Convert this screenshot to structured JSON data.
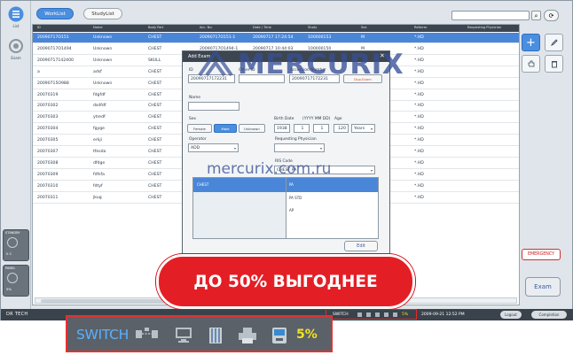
{
  "left_nav": {
    "worklist_label": "List",
    "exam_label": "Exam",
    "status_blocks": [
      {
        "label": "STANDBY",
        "value": "0 C"
      },
      {
        "label": "PANEL",
        "value": "5%"
      }
    ]
  },
  "top_bar": {
    "tabs": [
      "WorkList",
      "StudyList"
    ],
    "search_icon": "search-icon",
    "refresh_icon": "refresh-icon"
  },
  "table": {
    "columns": [
      "ID",
      "Name",
      "Body Part",
      "Acc. No.",
      "Date / Time",
      "Study",
      "Sex",
      "Referrer",
      "Requesting Physician"
    ],
    "rows": [
      {
        "id": "20090717O151",
        "name": "Unknown",
        "part": "CHEST",
        "acc": "20090717O151-1",
        "date": "20090717 17:24:54",
        "study": "100000153",
        "sex": "M",
        "ref": "*.HD",
        "selected": true
      },
      {
        "id": "20090717O1494",
        "name": "Unknown",
        "part": "CHEST",
        "acc": "20090717O1494-1",
        "date": "20090717 10:44:03",
        "study": "100000150",
        "sex": "M",
        "ref": "*.HD",
        "selected": false
      },
      {
        "id": "20090717142400",
        "name": "Unknown",
        "part": "SKULL",
        "acc": "20090717142400",
        "date": "20090717 14:23:44",
        "study": "100000153",
        "sex": "M",
        "ref": "*.HD",
        "selected": false
      },
      {
        "id": "a",
        "name": "adsf",
        "part": "CHEST",
        "acc": "",
        "date": "",
        "study": "",
        "sex": "",
        "ref": "*.HD",
        "selected": false
      },
      {
        "id": "20090715O988",
        "name": "Unknown",
        "part": "CHEST",
        "acc": "",
        "date": "",
        "study": "",
        "sex": "",
        "ref": "*.HD",
        "selected": false
      },
      {
        "id": "20070319",
        "name": "fdgfdf",
        "part": "CHEST",
        "acc": "",
        "date": "",
        "study": "",
        "sex": "",
        "ref": "*.HD",
        "selected": false
      },
      {
        "id": "20070302",
        "name": "dsdfdf",
        "part": "CHEST",
        "acc": "",
        "date": "",
        "study": "",
        "sex": "",
        "ref": "*.HD",
        "selected": false
      },
      {
        "id": "20070303",
        "name": "ytredf",
        "part": "CHEST",
        "acc": "",
        "date": "",
        "study": "",
        "sex": "",
        "ref": "*.HD",
        "selected": false
      },
      {
        "id": "20070304",
        "name": "fgyge",
        "part": "CHEST",
        "acc": "",
        "date": "",
        "study": "",
        "sex": "",
        "ref": "*.HD",
        "selected": false
      },
      {
        "id": "20070305",
        "name": "erkji",
        "part": "CHEST",
        "acc": "",
        "date": "",
        "study": "",
        "sex": "",
        "ref": "*.HD",
        "selected": false
      },
      {
        "id": "20070307",
        "name": "tfesda",
        "part": "CHEST",
        "acc": "",
        "date": "",
        "study": "",
        "sex": "",
        "ref": "*.HD",
        "selected": false
      },
      {
        "id": "20070308",
        "name": "dfdge",
        "part": "CHEST",
        "acc": "",
        "date": "",
        "study": "",
        "sex": "",
        "ref": "*.HD",
        "selected": false
      },
      {
        "id": "20070309",
        "name": "fdfsfa",
        "part": "CHEST",
        "acc": "",
        "date": "",
        "study": "",
        "sex": "",
        "ref": "*.HD",
        "selected": false
      },
      {
        "id": "20070310",
        "name": "fdtyf",
        "part": "CHEST",
        "acc": "",
        "date": "",
        "study": "",
        "sex": "",
        "ref": "*.HD",
        "selected": false
      },
      {
        "id": "20070311",
        "name": "jkug",
        "part": "CHEST",
        "acc": "",
        "date": "",
        "study": "",
        "sex": "",
        "ref": "*.HD",
        "selected": false
      }
    ]
  },
  "right_panel": {
    "emergency_label": "EMERGENCY",
    "exam_label": "Exam"
  },
  "status_bar": {
    "brand": "DR TECH",
    "switch_label": "SWITCH",
    "percent": "5%",
    "datetime": "2009-09-21 12:52 PM",
    "logout_label": "Logout",
    "complete_label": "Completion"
  },
  "modal": {
    "title": "Add Exam",
    "id_label": "ID",
    "id_value": "20090717172231",
    "other_id_label": "Other ID",
    "accession_label": "Accession Number",
    "accession_value": "20090717172231",
    "dup_exam_label": "Dup.Exam",
    "name_label": "Name",
    "sex_label": "Sex",
    "sex_options": [
      "Female",
      "Male",
      "Unknown"
    ],
    "birth_label": "Birth Date",
    "birth_format": "(YYYY MM DD)",
    "age_label": "Age",
    "birth_year": "1938",
    "birth_month": "1",
    "birth_day": "1",
    "age_value": "120",
    "age_unit": "Years",
    "operator_label": "Operator",
    "operator_value": "ADD",
    "req_phys_label": "Requesting Physician",
    "ris_label": "RIS Code",
    "ris_value": "CHEST PA",
    "bodypart_selected": "CHEST",
    "projections": [
      "PA",
      "PA STD",
      "AP"
    ],
    "edit_label": "Edit"
  },
  "watermark": {
    "logo": "MERCURIX",
    "url": "mercurix.com.ru"
  },
  "promo": {
    "text": "ДО 50% ВЫГОДНЕЕ"
  },
  "colors": {
    "accent": "#4a8ee0",
    "selected_row": "#4a86d8",
    "promo_red": "#e41e25",
    "emergency": "#d02020",
    "percent_yellow": "#f2e21a"
  }
}
